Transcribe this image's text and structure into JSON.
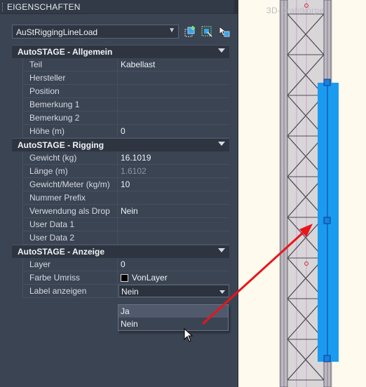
{
  "palette": {
    "title": "EIGENSCHAFTEN",
    "object_type": "AuStRiggingLineLoad"
  },
  "toolbar": {
    "icons": [
      "add-to-selection-icon",
      "quick-select-icon",
      "toggle-pickadd-icon"
    ]
  },
  "sections": [
    {
      "title": "AutoSTAGE - Allgemein",
      "rows": [
        {
          "name": "Teil",
          "value": "Kabellast"
        },
        {
          "name": "Hersteller",
          "value": ""
        },
        {
          "name": "Position",
          "value": ""
        },
        {
          "name": "Bemerkung 1",
          "value": ""
        },
        {
          "name": "Bemerkung 2",
          "value": ""
        },
        {
          "name": "Höhe (m)",
          "value": "0"
        }
      ]
    },
    {
      "title": "AutoSTAGE - Rigging",
      "rows": [
        {
          "name": "Gewicht (kg)",
          "value": "16.1019"
        },
        {
          "name": "Länge (m)",
          "value": "1.6102"
        },
        {
          "name": "Gewicht/Meter (kg/m)",
          "value": "10"
        },
        {
          "name": "Nummer Prefix",
          "value": ""
        },
        {
          "name": "Verwendung als Drop",
          "value": "Nein"
        },
        {
          "name": "User Data 1",
          "value": ""
        },
        {
          "name": "User Data 2",
          "value": ""
        }
      ]
    },
    {
      "title": "AutoSTAGE - Anzeige",
      "rows": [
        {
          "name": "Layer",
          "value": "0"
        },
        {
          "name": "Farbe Umriss",
          "value": "VonLayer"
        },
        {
          "name": "Label anzeigen",
          "value": "Nein"
        }
      ]
    }
  ],
  "dropdown": {
    "options": [
      "Ja",
      "Nein"
    ],
    "highlighted": "Ja"
  },
  "viewport": {
    "label": "3D-Drahtkörper"
  },
  "colors": {
    "panel_bg": "#3b4453",
    "section_bg": "#2e3541",
    "viewport_bg": "#fffaee",
    "selected_object": "#1a9bf0",
    "annotation_arrow": "#e8151b"
  }
}
